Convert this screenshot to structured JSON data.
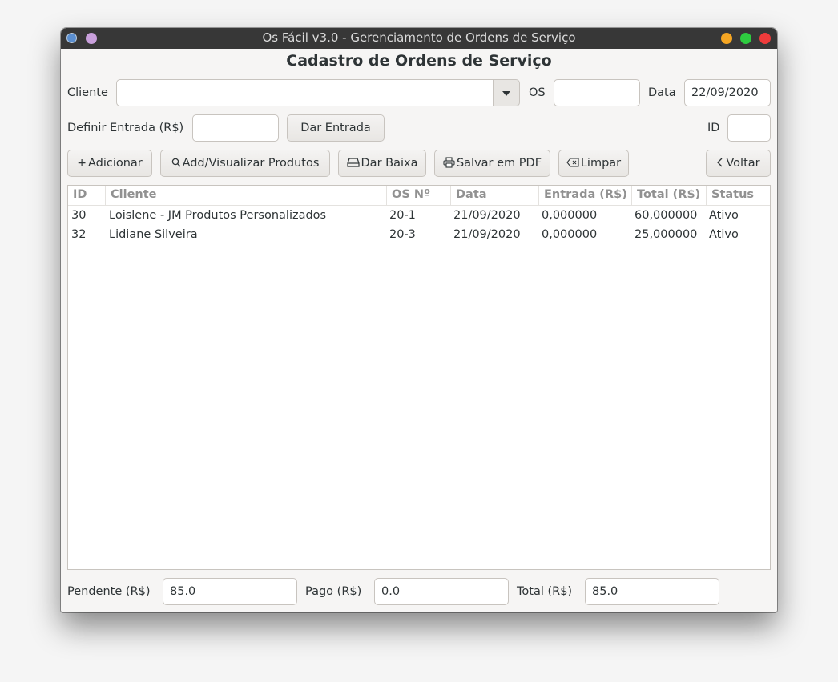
{
  "window": {
    "title": "Os Fácil v3.0 - Gerenciamento de Ordens de Serviço",
    "colors": {
      "minimize": "#f5a623",
      "maximize": "#2ecc40",
      "close": "#ee3b3b"
    }
  },
  "form": {
    "heading": "Cadastro de Ordens de Serviço",
    "cliente_label": "Cliente",
    "cliente_value": "",
    "os_label": "OS",
    "os_value": "",
    "data_label": "Data",
    "data_value": "22/09/2020",
    "entrada_label": "Definir Entrada (R$)",
    "entrada_value": "",
    "dar_entrada_label": "Dar Entrada",
    "id_label": "ID",
    "id_value": ""
  },
  "toolbar": {
    "adicionar": {
      "icon": "plus-icon",
      "label": "Adicionar"
    },
    "produtos": {
      "icon": "search-icon",
      "label": "Add/Visualizar Produtos"
    },
    "baixa": {
      "icon": "drive-icon",
      "label": "Dar Baixa"
    },
    "pdf": {
      "icon": "printer-icon",
      "label": "Salvar em PDF"
    },
    "limpar": {
      "icon": "clear-icon",
      "label": "Limpar"
    },
    "voltar": {
      "icon": "chevron-left-icon",
      "label": "Voltar"
    }
  },
  "table": {
    "columns": [
      "ID",
      "Cliente",
      "OS Nº",
      "Data",
      "Entrada (R$)",
      "Total (R$)",
      "Status"
    ],
    "rows": [
      [
        "30",
        "Loislene - JM Produtos Personalizados",
        "20-1",
        "21/09/2020",
        "0,000000",
        "60,000000",
        "Ativo"
      ],
      [
        "32",
        "Lidiane Silveira",
        "20-3",
        "21/09/2020",
        "0,000000",
        "25,000000",
        "Ativo"
      ]
    ]
  },
  "footer": {
    "pendente_label": "Pendente (R$)",
    "pendente_value": "85.0",
    "pago_label": "Pago (R$)",
    "pago_value": "0.0",
    "total_label": "Total (R$)",
    "total_value": "85.0"
  }
}
